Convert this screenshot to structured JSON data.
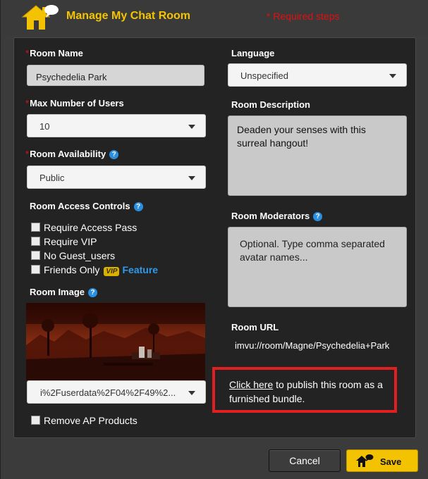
{
  "header": {
    "title": "Manage My Chat Room",
    "required_note": "* Required steps"
  },
  "form": {
    "room_name": {
      "label": "Room Name",
      "required_mark": "*",
      "value": "Psychedelia Park"
    },
    "max_users": {
      "label": "Max Number of Users",
      "required_mark": "*",
      "value": "10"
    },
    "availability": {
      "label": "Room Availability",
      "required_mark": "*",
      "value": "Public",
      "help_icon": "help-icon"
    },
    "access_controls": {
      "label": "Room Access Controls",
      "help_icon": "help-icon",
      "options": [
        {
          "label": "Require Access Pass",
          "checked": false
        },
        {
          "label": "Require VIP",
          "checked": false
        },
        {
          "label": "No Guest_users",
          "checked": false
        },
        {
          "label": "Friends Only",
          "checked": false
        }
      ],
      "vip_badge": "VIP",
      "feature_link": "Feature"
    },
    "room_image": {
      "label": "Room Image",
      "file_value": "i%2Fuserdata%2F04%2F49%2..."
    },
    "remove_ap": {
      "label": "Remove AP Products",
      "checked": false
    },
    "language": {
      "label": "Language",
      "value": "Unspecified"
    },
    "description": {
      "label": "Room Description",
      "value": "Deaden your senses with this surreal hangout!"
    },
    "moderators": {
      "label": "Room Moderators",
      "placeholder": "Optional. Type comma separated avatar names..."
    },
    "room_url": {
      "label": "Room URL",
      "value": "imvu://room/Magne/Psychedelia+Park"
    },
    "publish": {
      "link_text": "Click here",
      "rest_text": " to publish this room as a furnished bundle."
    }
  },
  "buttons": {
    "cancel": "Cancel",
    "save": "Save"
  },
  "colors": {
    "accent_yellow": "#f3c200",
    "required_red": "#e01010",
    "help_blue": "#2a8fe0",
    "highlight_red": "#e02020"
  }
}
